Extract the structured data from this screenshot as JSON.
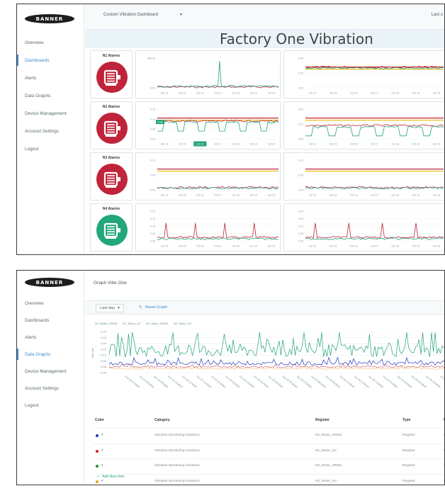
{
  "brand": {
    "logo_text": "BANNER"
  },
  "colors": {
    "alarm_red": "#c0243a",
    "alarm_green": "#23a779",
    "accent": "#3d8bd0",
    "trace_green": "#1fa37a",
    "trace_red": "#c0243a",
    "trace_blue": "#2438c0",
    "trace_orange": "#e8a13b",
    "warn_yellow": "#e9c21c"
  },
  "dashboard": {
    "sidebar": {
      "items": [
        "Overview",
        "Dashboards",
        "Alerts",
        "Data Graphs",
        "Device Management",
        "Account Settings",
        "Logout"
      ],
      "active_index": 1
    },
    "selector_label": "Custom Vibration Dashboard",
    "selector_icon": "chevron-down-icon",
    "top_right": "Last u",
    "title": "Factory One Vibration",
    "alarms": [
      {
        "title": "N1 Alarms",
        "status": "alarm",
        "icon": "motor-icon"
      },
      {
        "title": "N2 Alarms",
        "status": "alarm",
        "icon": "motor-icon"
      },
      {
        "title": "N3 Alarms",
        "status": "alarm",
        "icon": "motor-icon"
      },
      {
        "title": "N4 Alarms",
        "status": "ok",
        "icon": "motor-icon"
      }
    ],
    "charts": [
      {
        "y_ticks": [
          "500.00",
          "0.00"
        ],
        "dates": [
          "Oct 14",
          "Oct 15",
          "Oct 16",
          "Oct 17",
          "Oct 18",
          "Oct 19",
          "Oct 20"
        ]
      },
      {
        "y_ticks": [
          "0.40",
          "0.20",
          "0.00"
        ],
        "dates": [
          "Oct 14",
          "Oct 15",
          "Oct 16",
          "Oct 17",
          "Oct 18",
          "Oct 19",
          "Oct 20"
        ]
      },
      {
        "y_ticks": [
          "0.15",
          "0.10",
          "0.05",
          "0.00"
        ],
        "dates": [
          "Oct 14",
          "Oct 15",
          "Oct 16",
          "Oct 17",
          "Oct 18",
          "Oct 19",
          "Oct 20"
        ],
        "highlight_date": "Oct 16",
        "marker_value": "0.08"
      },
      {
        "y_ticks": [
          "0.02",
          "0.01",
          "0.00"
        ],
        "dates": [
          "Oct 14",
          "Oct 15",
          "Oct 16",
          "Oct 17",
          "Oct 18",
          "Oct 19",
          "Oct 20"
        ]
      },
      {
        "y_ticks": [
          "0.10",
          "0.05",
          "0.00"
        ],
        "dates": [
          "Oct 14",
          "Oct 15",
          "Oct 16",
          "Oct 17",
          "Oct 18",
          "Oct 19",
          "Oct 20"
        ]
      },
      {
        "y_ticks": [
          "0.10",
          "0.05",
          "0.00"
        ],
        "dates": [
          "Oct 14",
          "Oct 15",
          "Oct 16",
          "Oct 17",
          "Oct 18",
          "Oct 19",
          "Oct 20"
        ]
      },
      {
        "y_ticks": [
          "0.20",
          "0.15",
          "0.10",
          "0.05",
          "0.00"
        ],
        "dates": [
          "Oct 14",
          "Oct 15",
          "Oct 16",
          "Oct 17",
          "Oct 18",
          "Oct 19",
          "Oct 20"
        ]
      },
      {
        "y_ticks": [
          "0.20",
          "0.15",
          "0.10",
          "0.05",
          "0.00"
        ],
        "dates": [
          "Oct 14",
          "Oct 15",
          "Oct 16",
          "Oct 17",
          "Oct 18",
          "Oct 19",
          "Oct 20"
        ]
      }
    ]
  },
  "graphs": {
    "sidebar": {
      "items": [
        "Overview",
        "Dashboards",
        "Alerts",
        "Data Graphs",
        "Device Management",
        "Account Settings",
        "Logout"
      ],
      "active_index": 3
    },
    "title": "Graph Vibe One",
    "range_label": "Last day",
    "range_icon": "chevron-down-icon",
    "reset_label": "Reset Graph",
    "reset_icon": "refresh-icon",
    "legend": [
      "N1_Motor_XRMS",
      "N1_Motor_ZV",
      "N2_Motor_ZRMS",
      "N2_Motor_XV"
    ],
    "y_label": "in/s rms",
    "y_ticks": [
      "0.24",
      "0.21",
      "0.18",
      "0.15",
      "0.12",
      "0.09",
      "0.06",
      "0.03"
    ],
    "x_ticks": [
      "Oct 19 07:00pm",
      "Oct 19 08:00pm",
      "Oct 19 09:00pm",
      "Oct 19 10:00pm",
      "Oct 19 11:00pm",
      "Oct 20 12:00am",
      "Oct 20 01:00am",
      "Oct 20 02:00am",
      "Oct 20 03:00am",
      "Oct 20 04:00am",
      "Oct 20 05:00am",
      "Oct 20 06:00am",
      "Oct 20 07:00am",
      "Oct 20 08:00am",
      "Oct 20 09:00am",
      "Oct 20 10:00am",
      "Oct 20 11:00am",
      "Oct 20 12:00pm",
      "Oct 20 01:00pm",
      "Oct 20 02:00pm",
      "Oct 20 03:00pm",
      "Oct 20 04:00pm",
      "Oct 20 05:00pm"
    ],
    "table": {
      "headers": [
        "Color",
        "Category",
        "Register",
        "Type",
        "U"
      ],
      "rows": [
        {
          "color": "#2438c0",
          "category": "Vibration Monitoring Solutions",
          "register": "N1_Motor_XRMS",
          "type": "Register",
          "unit": "in"
        },
        {
          "color": "#d21f2b",
          "category": "Vibration Monitoring Solutions",
          "register": "N1_Motor_ZV",
          "type": "Register",
          "unit": "in"
        },
        {
          "color": "#1f8f3a",
          "category": "Vibration Monitoring Solutions",
          "register": "N2_Motor_ZRMS",
          "type": "Register",
          "unit": "in"
        },
        {
          "color": "#f0a01c",
          "category": "Vibration Monitoring Solutions",
          "register": "N2_Motor_XV",
          "type": "Register",
          "unit": "in"
        }
      ],
      "add_label": "Add New Item",
      "add_icon": "plus-icon"
    }
  }
}
